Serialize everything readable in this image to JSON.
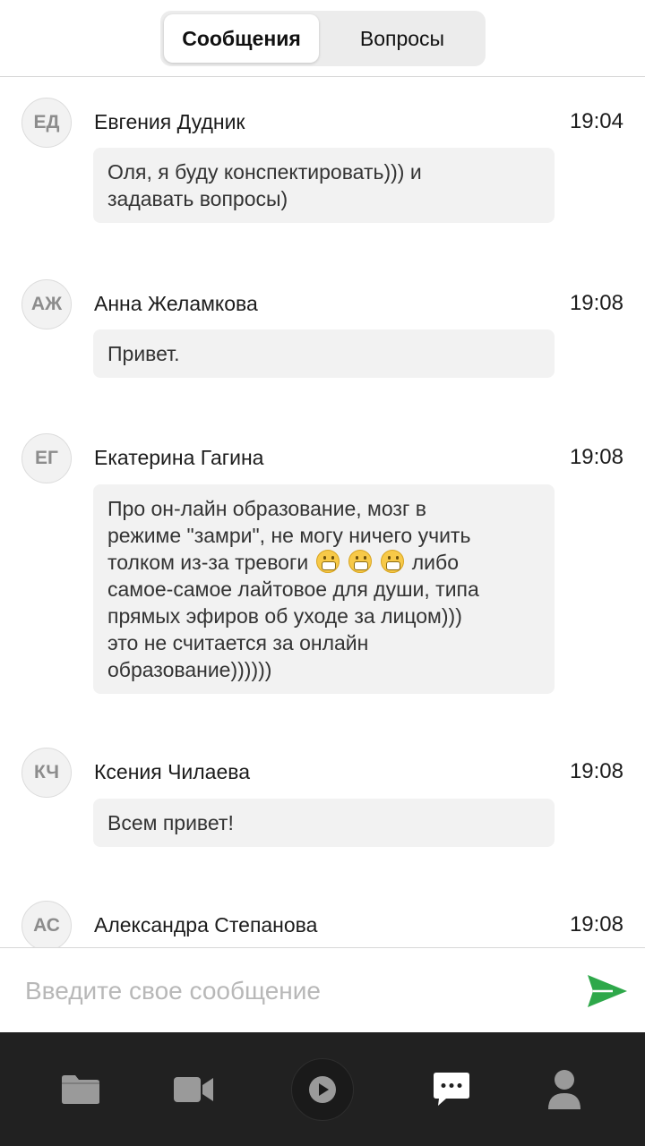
{
  "tabs": [
    {
      "label": "Сообщения",
      "active": true
    },
    {
      "label": "Вопросы",
      "active": false
    }
  ],
  "messages": [
    {
      "initials": "ЕД",
      "author": "Евгения Дудник",
      "time": "19:04",
      "lines": [
        "Оля, я буду конспектировать))) и",
        "задавать вопросы)"
      ]
    },
    {
      "initials": "АЖ",
      "author": "Анна Желамкова",
      "time": "19:08",
      "lines": [
        "Привет."
      ]
    },
    {
      "initials": "ЕГ",
      "author": "Екатерина Гагина",
      "time": "19:08",
      "lines": [
        "Про он-лайн образование, мозг в",
        "режиме \"замри\", не могу ничего учить",
        "толком из-за тревоги",
        "либо",
        "самое-самое лайтовое для души, типа",
        "прямых эфиров об уходе за лицом)))",
        "это не считается за онлайн",
        "образование))))))"
      ]
    },
    {
      "initials": "КЧ",
      "author": "Ксения Чилаева",
      "time": "19:08",
      "lines": [
        "Всем привет!"
      ]
    },
    {
      "initials": "АС",
      "author": "Александра Степанова",
      "time": "19:08",
      "lines": []
    }
  ],
  "input": {
    "placeholder": "Введите свое сообщение"
  },
  "colors": {
    "send_accent": "#2ea84a",
    "nav_background": "#212121",
    "bubble": "#f2f2f2"
  },
  "nav": [
    "folder-icon",
    "video-camera-icon",
    "play-icon",
    "chat-icon",
    "profile-icon"
  ]
}
